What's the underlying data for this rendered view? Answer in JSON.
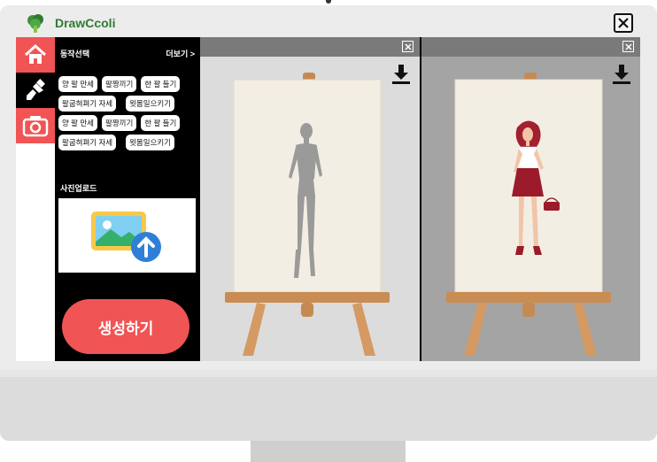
{
  "app": {
    "title": "DrawCcoli",
    "logo_icon": "broccoli-logo-icon",
    "close_icon": "close-icon"
  },
  "nav": {
    "items": [
      {
        "icon": "home-icon",
        "active": false
      },
      {
        "icon": "brush-icon",
        "active": true
      },
      {
        "icon": "camera-icon",
        "active": false
      }
    ]
  },
  "panel": {
    "section_title": "동작선택",
    "more_label": "더보기 >",
    "pose_group_1": [
      "양 팔 만세",
      "팔짱끼기",
      "한 팔 들기",
      "팔굽혀펴기 자세",
      "윗몸일으키기"
    ],
    "pose_group_2": [
      "양 팔 만세",
      "팔짱끼기",
      "한 팔 들기",
      "팔굽혀펴기 자세",
      "윗몸일으키기"
    ],
    "upload_label": "사진업로드",
    "upload_icon": "image-upload-icon",
    "generate_label": "생성하기"
  },
  "viewers": [
    {
      "content": "mannequin-pose",
      "close_icon": "close-box-icon",
      "download_icon": "download-icon"
    },
    {
      "content": "fashion-figure-drawing",
      "close_icon": "close-box-icon",
      "download_icon": "download-icon"
    }
  ],
  "colors": {
    "accent": "#f05454",
    "brand_green": "#2e7d32",
    "panel_bg": "#000000",
    "viewer_bar": "#7a7a7a"
  }
}
